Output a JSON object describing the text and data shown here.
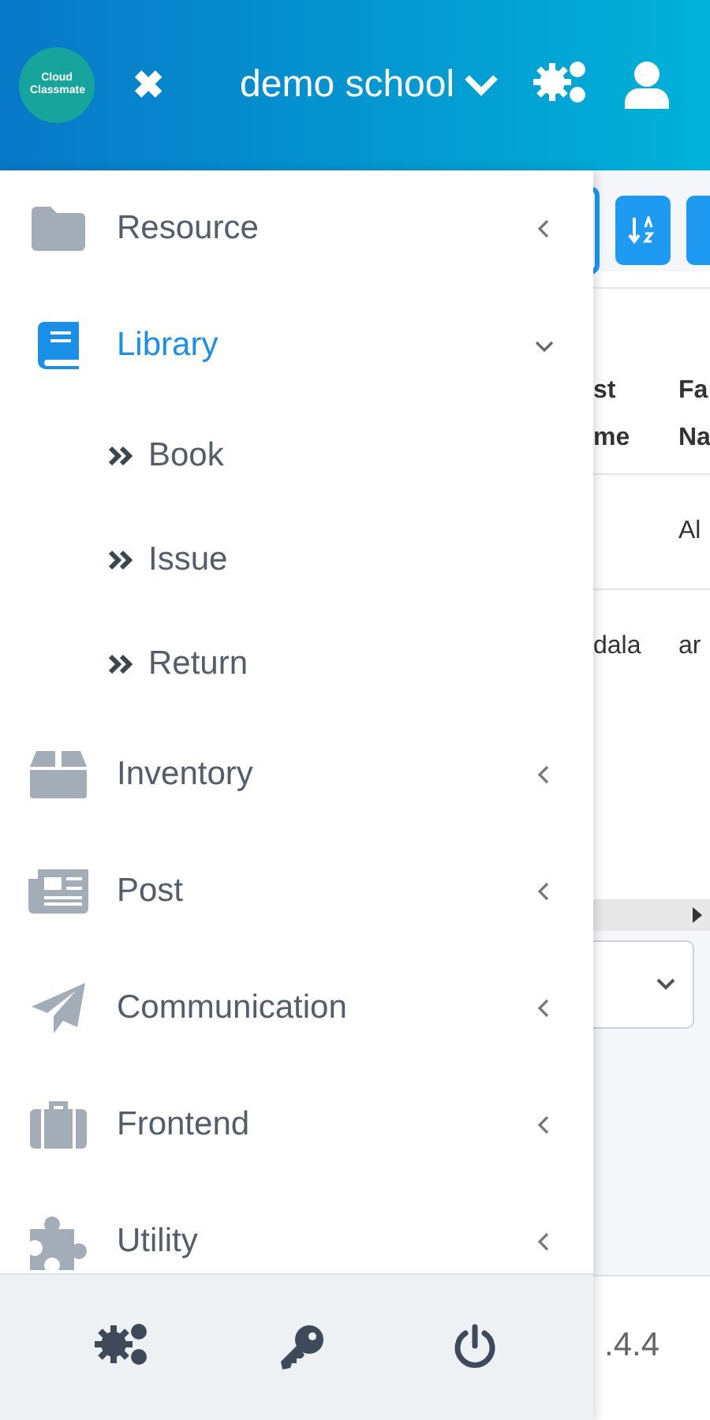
{
  "header": {
    "logo_text": "Cloud Classmate",
    "close_icon": "✖",
    "school": "demo school"
  },
  "sidebar": {
    "items": [
      {
        "label": "Resource",
        "selected": false,
        "expanded": false
      },
      {
        "label": "Library",
        "selected": true,
        "expanded": true,
        "children": [
          {
            "label": "Book"
          },
          {
            "label": "Issue"
          },
          {
            "label": "Return"
          }
        ]
      },
      {
        "label": "Inventory",
        "selected": false,
        "expanded": false
      },
      {
        "label": "Post",
        "selected": false,
        "expanded": false
      },
      {
        "label": "Communication",
        "selected": false,
        "expanded": false
      },
      {
        "label": "Frontend",
        "selected": false,
        "expanded": false
      },
      {
        "label": "Utility",
        "selected": false,
        "expanded": false
      }
    ]
  },
  "table": {
    "columns": [
      "st me",
      "Fa Na"
    ],
    "rows": [
      {
        "column_2": "Al"
      },
      {
        "column_1": "dala",
        "column_2": "ar"
      }
    ]
  },
  "footer": {
    "version": ".4.4"
  }
}
